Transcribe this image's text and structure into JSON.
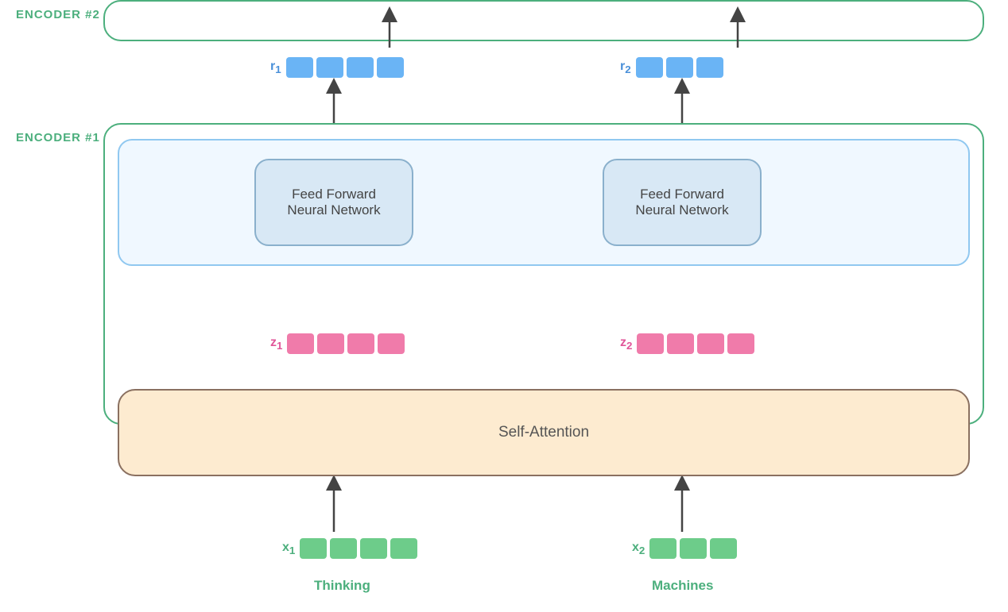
{
  "labels": {
    "encoder2": "ENCODER #2",
    "encoder1": "ENCODER #1",
    "ffn_left": "Feed Forward\nNeural Network",
    "ffn_right": "Feed Forward\nNeural Network",
    "self_attention": "Self-Attention",
    "thinking": "Thinking",
    "machines": "Machines"
  },
  "vectors": {
    "r1_label": "r",
    "r1_sub": "1",
    "r2_label": "r",
    "r2_sub": "2",
    "z1_label": "z",
    "z1_sub": "1",
    "z2_label": "z",
    "z2_sub": "2",
    "x1_label": "x",
    "x1_sub": "1",
    "x2_label": "x",
    "x2_sub": "2"
  },
  "colors": {
    "green_border": "#4caf7d",
    "blue_light": "#90c8f0",
    "ffn_bg": "#d8e8f5",
    "ffn_border": "#8ab0cc",
    "sa_bg": "#fdebd0",
    "sa_border": "#8a7060",
    "block_blue": "#6ab4f5",
    "block_pink": "#f07baa",
    "block_green": "#6dcc8a",
    "arrow": "#444",
    "r_label_color": "#4a90d9",
    "z_label_color": "#e05599",
    "x_label_color": "#4caf7d",
    "word_color": "#4caf7d"
  }
}
